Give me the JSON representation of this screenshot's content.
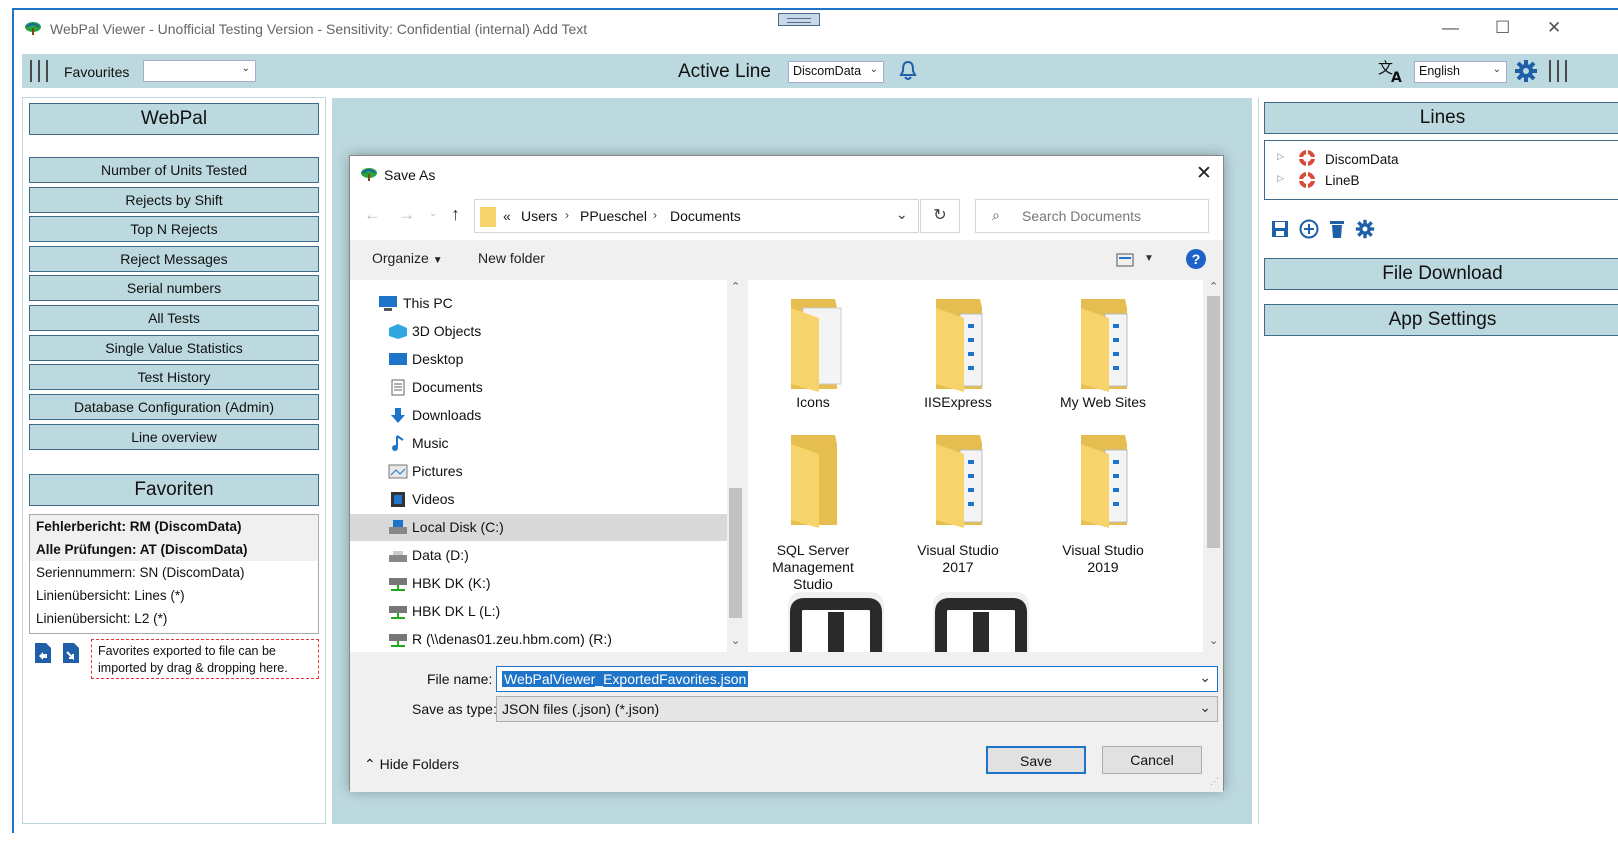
{
  "window": {
    "title": "WebPal Viewer - Unofficial Testing Version - Sensitivity: Confidential (internal) Add Text",
    "minimize": "—",
    "maximize": "☐",
    "close": "✕"
  },
  "toolbar": {
    "favourites_label": "Favourites",
    "favourites_value": "",
    "active_line_label": "Active Line",
    "active_line_value": "DiscomData",
    "language_value": "English"
  },
  "left_panel": {
    "header": "WebPal",
    "nav_items": [
      "Number of Units Tested",
      "Rejects by Shift",
      "Top N Rejects",
      "Reject Messages",
      "Serial numbers",
      "All Tests",
      "Single Value Statistics",
      "Test History",
      "Database Configuration (Admin)",
      "Line overview"
    ],
    "favorites_header": "Favoriten",
    "favorites": [
      "Fehlerbericht: RM (DiscomData)",
      "Alle Prüfungen: AT (DiscomData)",
      "Seriennummern: SN (DiscomData)",
      "Linienübersicht: Lines (*)",
      "Linienübersicht: L2 (*)"
    ],
    "drop_note": "Favorites exported to file can be imported by drag & dropping here."
  },
  "right_panel": {
    "lines_header": "Lines",
    "lines": [
      "DiscomData",
      "LineB"
    ],
    "file_download": "File Download",
    "app_settings": "App Settings"
  },
  "dialog": {
    "title": "Save As",
    "breadcrumb": [
      "«",
      "Users",
      "PPueschel",
      "Documents"
    ],
    "search_placeholder": "Search Documents",
    "organize": "Organize",
    "new_folder": "New folder",
    "tree": [
      "This PC",
      "3D Objects",
      "Desktop",
      "Documents",
      "Downloads",
      "Music",
      "Pictures",
      "Videos",
      "Local Disk (C:)",
      "Data (D:)",
      "HBK DK (K:)",
      "HBK DK L (L:)",
      "R (\\\\denas01.zeu.hbm.com) (R:)"
    ],
    "folders": [
      {
        "line1": "Icons",
        "line2": "",
        "line3": ""
      },
      {
        "line1": "IISExpress",
        "line2": "",
        "line3": ""
      },
      {
        "line1": "My Web Sites",
        "line2": "",
        "line3": ""
      },
      {
        "line1": "SQL Server",
        "line2": "Management",
        "line3": "Studio"
      },
      {
        "line1": "Visual Studio",
        "line2": "2017",
        "line3": ""
      },
      {
        "line1": "Visual Studio",
        "line2": "2019",
        "line3": ""
      }
    ],
    "file_name_label": "File name:",
    "file_name_value": "WebPalViewer_ExportedFavorites.json",
    "save_type_label": "Save as type:",
    "save_type_value": "JSON files (.json) (*.json)",
    "hide_folders": "Hide Folders",
    "save": "Save",
    "cancel": "Cancel"
  },
  "colors": {
    "panel_bg": "#bcd9df",
    "border_dark": "#3f6a8a",
    "accent_blue": "#1e74c8",
    "folder_yellow": "#f6d46b"
  }
}
